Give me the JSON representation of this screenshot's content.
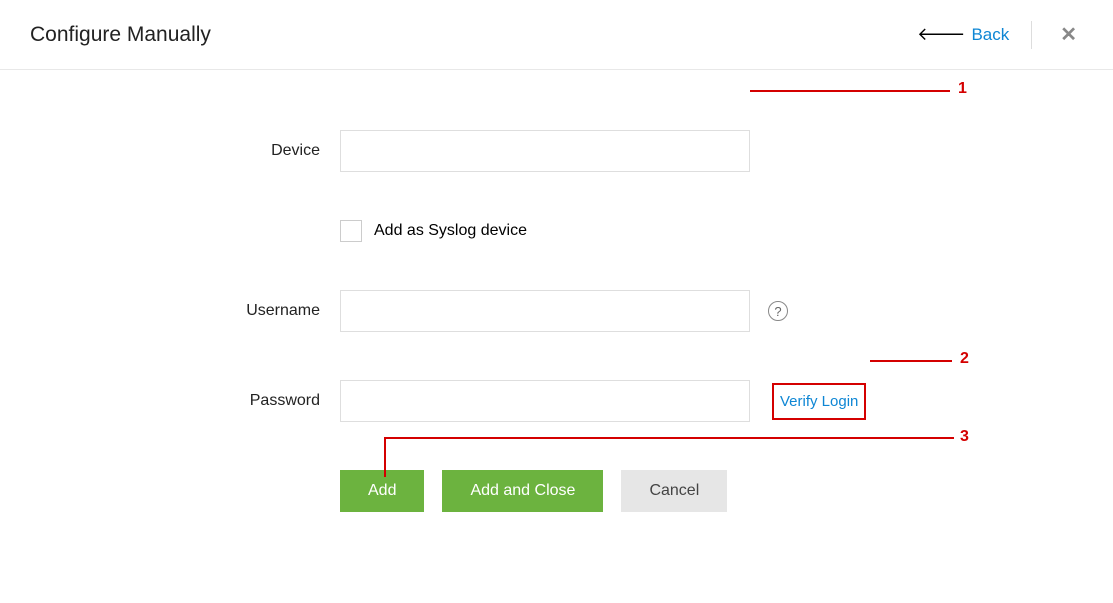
{
  "header": {
    "title": "Configure Manually",
    "back_label": "Back"
  },
  "form": {
    "device_label": "Device",
    "device_value": "",
    "syslog_checkbox_label": "Add as Syslog device",
    "username_label": "Username",
    "username_value": "",
    "password_label": "Password",
    "password_value": "",
    "verify_login_label": "Verify Login"
  },
  "buttons": {
    "add": "Add",
    "add_and_close": "Add and Close",
    "cancel": "Cancel"
  },
  "annotations": {
    "one": "1",
    "two": "2",
    "three": "3"
  }
}
